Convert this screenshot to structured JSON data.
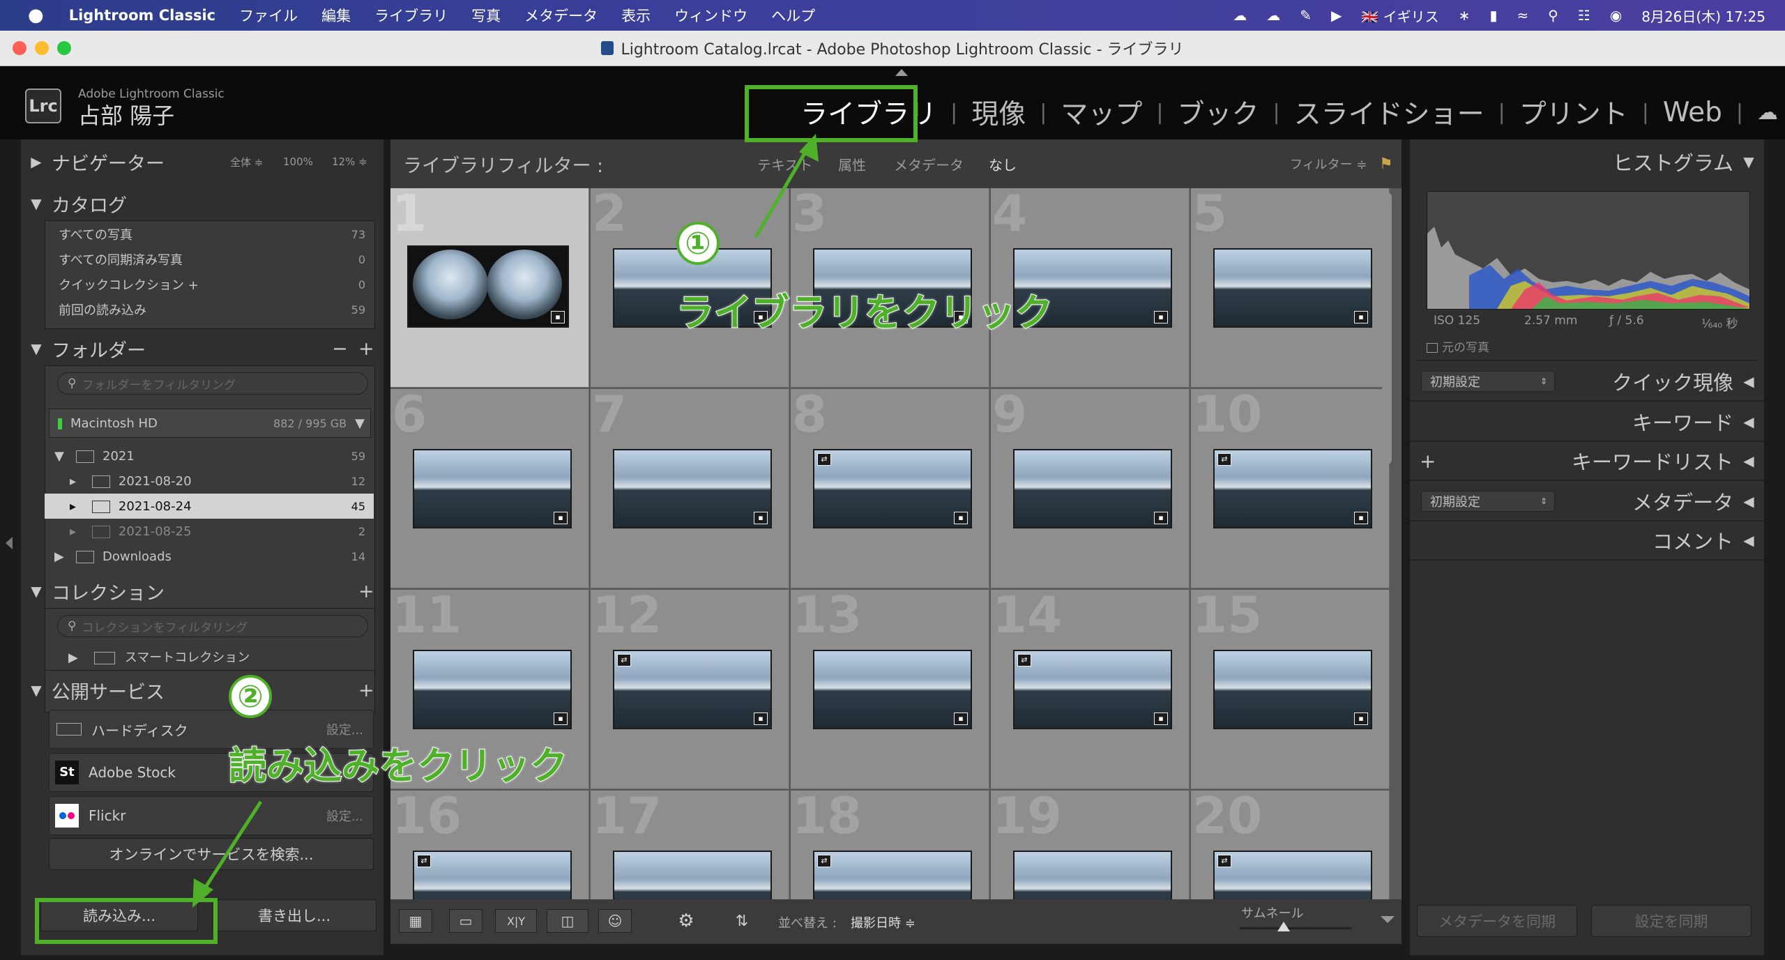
{
  "menubar": {
    "apple": "",
    "app": "Lightroom Classic",
    "items": [
      "ファイル",
      "編集",
      "ライブラリ",
      "写真",
      "メタデータ",
      "表示",
      "ウィンドウ",
      "ヘルプ"
    ],
    "input_source": "🇬🇧 イギリス",
    "clock": "8月26日(木)  17:25"
  },
  "window": {
    "title": "Lightroom Catalog.lrcat - Adobe Photoshop Lightroom Classic - ライブラリ"
  },
  "header": {
    "logo": "Lrc",
    "brand": "Adobe Lightroom Classic",
    "user": "占部 陽子",
    "modules": [
      "ライブラリ",
      "現像",
      "マップ",
      "ブック",
      "スライドショー",
      "プリント",
      "Web"
    ]
  },
  "navigator": {
    "title": "ナビゲーター",
    "zoom": [
      "全体 ≑",
      "100%",
      "12%  ≑"
    ]
  },
  "catalog": {
    "title": "カタログ",
    "items": [
      {
        "label": "すべての写真",
        "count": "73"
      },
      {
        "label": "すべての同期済み写真",
        "count": "0"
      },
      {
        "label": "クイックコレクション +",
        "count": "0"
      },
      {
        "label": "前回の読み込み",
        "count": "59"
      }
    ]
  },
  "folders": {
    "title": "フォルダー",
    "search_placeholder": "フォルダーをフィルタリング",
    "volume": {
      "name": "Macintosh HD",
      "space": "882 / 995 GB"
    },
    "items": [
      {
        "label": "2021",
        "count": "59"
      },
      {
        "label": "2021-08-20",
        "count": "12"
      },
      {
        "label": "2021-08-24",
        "count": "45"
      },
      {
        "label": "2021-08-25",
        "count": "2"
      },
      {
        "label": "Downloads",
        "count": "14"
      }
    ]
  },
  "collections": {
    "title": "コレクション",
    "search_placeholder": "コレクションをフィルタリング",
    "items": [
      "スマートコレクション"
    ]
  },
  "publish": {
    "title": "公開サービス",
    "services": [
      {
        "label": "ハードディスク",
        "action": "設定..."
      },
      {
        "label": "Adobe Stock",
        "action": ""
      },
      {
        "label": "Flickr",
        "action": "設定..."
      }
    ],
    "find_more": "オンラインでサービスを検索..."
  },
  "bottom_left": {
    "import": "読み込み...",
    "export": "書き出し..."
  },
  "filterbar": {
    "title": "ライブラリフィルター :",
    "options": [
      "テキスト",
      "属性",
      "メタデータ",
      "なし"
    ],
    "preset": "フィルター ≑"
  },
  "grid": {
    "numbers": [
      "1",
      "2",
      "3",
      "4",
      "5",
      "6",
      "7",
      "8",
      "9",
      "10",
      "11",
      "12",
      "13",
      "14",
      "15",
      "16",
      "17",
      "18",
      "19",
      "20"
    ]
  },
  "toolbar": {
    "sort_label": "並べ替え :",
    "sort_value": "撮影日時 ≑",
    "thumb_label": "サムネール"
  },
  "right_panel": {
    "histogram_title": "ヒストグラム",
    "info": {
      "iso": "ISO 125",
      "focal": "2.57 mm",
      "aperture": "ƒ / 5.6",
      "shutter": "¹⁄₆₄₀ 秒"
    },
    "original_photo": "元の写真",
    "panels": [
      "クイック現像",
      "キーワード",
      "キーワードリスト",
      "メタデータ",
      "コメント"
    ],
    "preset_default": "初期設定",
    "sync_metadata": "メタデータを同期",
    "sync_settings": "設定を同期"
  },
  "annotations": {
    "step1_num": "①",
    "step1": "ライブラリをクリック",
    "step2_num": "②",
    "step2": "読み込みをクリック",
    "color": "#4fb02a"
  }
}
